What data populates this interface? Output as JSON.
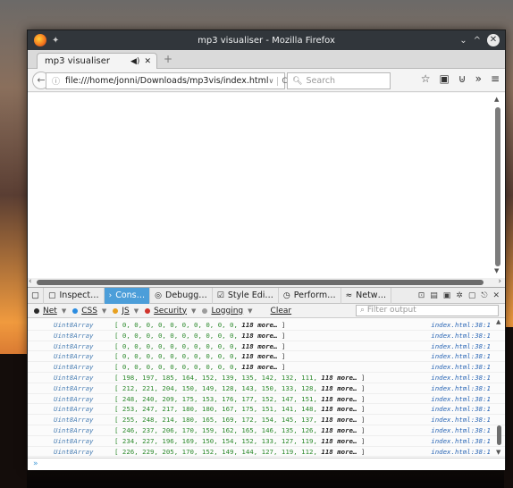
{
  "window": {
    "title": "mp3 visualiser - Mozilla Firefox",
    "controls": {
      "minimize": "⌄",
      "maximize": "^",
      "close": "✕"
    }
  },
  "tab": {
    "label": "mp3 visualiser",
    "speaker": "◀)",
    "close": "✕",
    "new": "+"
  },
  "navbar": {
    "back": "←",
    "url": "file:///home/jonni/Downloads/mp3vis/index.html",
    "url_dropdown": "∨",
    "reload": "C",
    "search_placeholder": "Search",
    "icons": [
      "star-icon",
      "bookmarks-icon",
      "pocket-icon",
      "overflow-icon",
      "menu-icon"
    ],
    "icon_glyphs": {
      "star": "☆",
      "bookmarks": "▣",
      "pocket": "⊍",
      "overflow": "»",
      "menu": "≡"
    }
  },
  "devtools": {
    "tabs": [
      "Inspect…",
      "Cons…",
      "Debugg…",
      "Style Edi…",
      "Perform…",
      "Netw…"
    ],
    "active_tab": "Cons…",
    "tab_icons": [
      "▢",
      "›",
      "◎",
      "☑",
      "◷",
      "≈"
    ],
    "toolbar_icons": [
      "⊡",
      "▤",
      "▣",
      "✲",
      "▢",
      "⎋",
      "✕"
    ],
    "filters": [
      {
        "label": "Net",
        "color": "#2a2a2a"
      },
      {
        "label": "CSS",
        "color": "#2b8ce0"
      },
      {
        "label": "JS",
        "color": "#e7a020"
      },
      {
        "label": "Security",
        "color": "#d0342c"
      },
      {
        "label": "Logging",
        "color": "#9c9c9c"
      }
    ],
    "clear": "Clear",
    "filter_placeholder": "Filter output",
    "prompt": "»"
  },
  "console": {
    "rows": [
      {
        "type": "Uint8Array",
        "values": "[ 0, 0, 0, 0, 0, 0, 0, 0, 0, 0,",
        "more": "118 more…",
        "end": "]",
        "source": "index.html:38:1"
      },
      {
        "type": "Uint8Array",
        "values": "[ 0, 0, 0, 0, 0, 0, 0, 0, 0, 0,",
        "more": "118 more…",
        "end": "]",
        "source": "index.html:38:1"
      },
      {
        "type": "Uint8Array",
        "values": "[ 0, 0, 0, 0, 0, 0, 0, 0, 0, 0,",
        "more": "118 more…",
        "end": "]",
        "source": "index.html:38:1"
      },
      {
        "type": "Uint8Array",
        "values": "[ 0, 0, 0, 0, 0, 0, 0, 0, 0, 0,",
        "more": "118 more…",
        "end": "]",
        "source": "index.html:38:1"
      },
      {
        "type": "Uint8Array",
        "values": "[ 0, 0, 0, 0, 0, 0, 0, 0, 0, 0,",
        "more": "118 more…",
        "end": "]",
        "source": "index.html:38:1"
      },
      {
        "type": "Uint8Array",
        "values": "[ 198, 197, 185, 164, 152, 139, 135, 142, 132, 111,",
        "more": "118 more…",
        "end": "]",
        "source": "index.html:38:1"
      },
      {
        "type": "Uint8Array",
        "values": "[ 212, 221, 204, 150, 149, 128, 143, 150, 133, 128,",
        "more": "118 more…",
        "end": "]",
        "source": "index.html:38:1"
      },
      {
        "type": "Uint8Array",
        "values": "[ 248, 240, 209, 175, 153, 176, 177, 152, 147, 151,",
        "more": "118 more…",
        "end": "]",
        "source": "index.html:38:1"
      },
      {
        "type": "Uint8Array",
        "values": "[ 253, 247, 217, 180, 180, 167, 175, 151, 141, 148,",
        "more": "118 more…",
        "end": "]",
        "source": "index.html:38:1"
      },
      {
        "type": "Uint8Array",
        "values": "[ 255, 248, 214, 180, 165, 169, 172, 154, 145, 137,",
        "more": "118 more…",
        "end": "]",
        "source": "index.html:38:1"
      },
      {
        "type": "Uint8Array",
        "values": "[ 246, 237, 206, 170, 159, 162, 165, 146, 135, 126,",
        "more": "118 more…",
        "end": "]",
        "source": "index.html:38:1"
      },
      {
        "type": "Uint8Array",
        "values": "[ 234, 227, 196, 169, 150, 154, 152, 133, 127, 119,",
        "more": "118 more…",
        "end": "]",
        "source": "index.html:38:1"
      },
      {
        "type": "Uint8Array",
        "values": "[ 226, 229, 205, 170, 152, 149, 144, 127, 119, 112,",
        "more": "118 more…",
        "end": "]",
        "source": "index.html:38:1"
      }
    ]
  }
}
